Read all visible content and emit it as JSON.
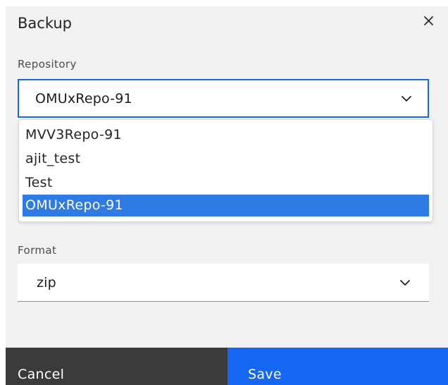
{
  "dialog": {
    "title": "Backup",
    "close_icon": "close-icon"
  },
  "repository": {
    "label": "Repository",
    "selected": "OMUxRepo-91",
    "options": [
      "MVV3Repo-91",
      "ajit_test",
      "Test",
      "OMUxRepo-91"
    ],
    "selected_index": 3,
    "chevron_icon": "chevron-down-icon"
  },
  "format": {
    "label": "Format",
    "selected": "zip",
    "chevron_icon": "chevron-down-icon"
  },
  "footer": {
    "cancel_label": "Cancel",
    "save_label": "Save"
  },
  "colors": {
    "dialog_background": "#f1f1f1",
    "focus_border": "#1a66e8",
    "selected_option": "#2f7be6",
    "cancel_button": "#3b3b3b",
    "save_button": "#1466f3"
  }
}
